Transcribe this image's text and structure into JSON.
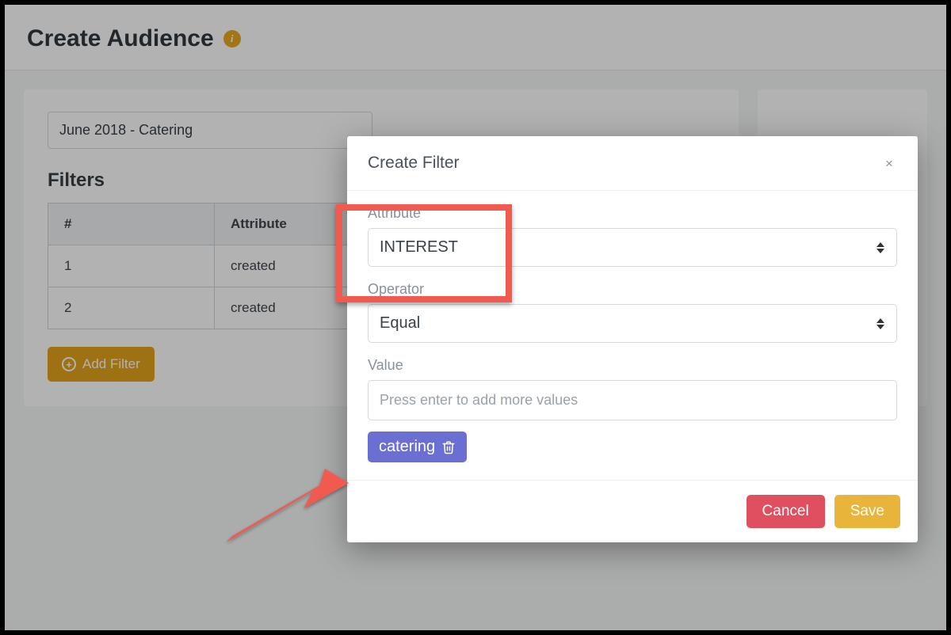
{
  "page": {
    "title": "Create Audience",
    "info_icon": "i"
  },
  "audience_name": "June 2018 - Catering",
  "filters": {
    "heading": "Filters",
    "columns": {
      "num": "#",
      "attribute": "Attribute"
    },
    "rows": [
      {
        "num": "1",
        "attribute": "created"
      },
      {
        "num": "2",
        "attribute": "created"
      }
    ],
    "add_button": "Add Filter"
  },
  "modal": {
    "title": "Create Filter",
    "attribute_label": "Attribute",
    "attribute_value": "INTEREST",
    "operator_label": "Operator",
    "operator_value": "Equal",
    "value_label": "Value",
    "value_placeholder": "Press enter to add more values",
    "tags": [
      "catering"
    ],
    "cancel": "Cancel",
    "save": "Save"
  }
}
